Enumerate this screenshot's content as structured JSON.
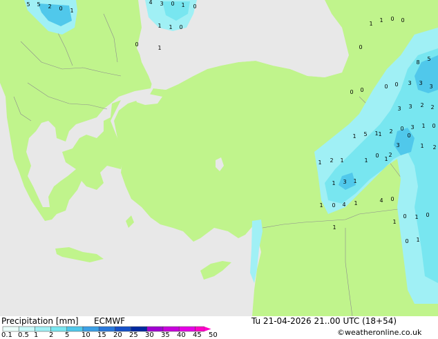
{
  "map": {
    "colors": {
      "sea": "#e8e8e8",
      "land": "#c0f48c",
      "border": "#8c8c8c"
    },
    "precip_labels": [
      "5",
      "5",
      "2",
      "0",
      "1",
      "4",
      "3",
      "0",
      "1",
      "0",
      "1",
      "1",
      "0",
      "0",
      "1",
      "1",
      "1",
      "0",
      "0",
      "0",
      "8",
      "5",
      "0",
      "0",
      "0",
      "0",
      "3",
      "3",
      "3",
      "3",
      "3",
      "2",
      "2",
      "1",
      "2",
      "0",
      "3",
      "1",
      "0",
      "0",
      "3",
      "1",
      "2",
      "1",
      "5",
      "1",
      "2",
      "1",
      "0",
      "1",
      "2",
      "1",
      "1",
      "1",
      "3",
      "1",
      "1",
      "0",
      "4",
      "1",
      "4",
      "0",
      "0",
      "1",
      "0",
      "1",
      "1",
      "0",
      "1"
    ]
  },
  "footer": {
    "title": "Precipitation [mm]",
    "model": "ECMWF",
    "datetime": "Tu 21-04-2026 21..00 UTC (18+54)",
    "credit": "©weatheronline.co.uk",
    "scale_labels": [
      "0.1",
      "0.5",
      "1",
      "2",
      "5",
      "10",
      "15",
      "20",
      "25",
      "30",
      "35",
      "40",
      "45",
      "50"
    ],
    "scale_colors": [
      "#ebfffa",
      "#c8fafa",
      "#a0f0f5",
      "#78e6f0",
      "#50c8eb",
      "#3ca0e6",
      "#2878dc",
      "#1450c8",
      "#0028a0",
      "#a000d2",
      "#c800dc",
      "#e600e6",
      "#ff00c8"
    ]
  }
}
